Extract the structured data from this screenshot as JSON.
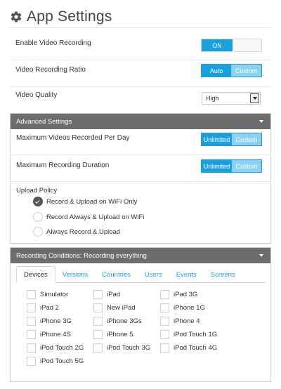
{
  "header": {
    "title": "App Settings",
    "icon": "gear-icon"
  },
  "settings": {
    "video_recording": {
      "label": "Enable Video Recording",
      "on": "ON",
      "off": ""
    },
    "ratio": {
      "label": "Video Recording Ratio",
      "auto": "Auto",
      "custom": "Custom"
    },
    "quality": {
      "label": "Video Quality",
      "value": "High"
    }
  },
  "advanced": {
    "title": "Advanced Settings",
    "max_videos": {
      "label": "Maximum Videos Recorded Per Day",
      "unlimited": "Unlimited",
      "custom": "Custom"
    },
    "max_duration": {
      "label": "Maximum Recording Duration",
      "unlimited": "Unlimited",
      "custom": "Custom"
    },
    "upload": {
      "label": "Upload Policy",
      "options": [
        "Record & Upload on WiFi Only",
        "Record Always & Upload on WiFi",
        "Always Record & Upload"
      ],
      "selected_index": 0
    }
  },
  "conditions": {
    "title": "Recording Conditions: Recording everything",
    "tabs": [
      "Devices",
      "Versions",
      "Countries",
      "Users",
      "Events",
      "Screens"
    ],
    "active_tab": "Devices",
    "devices": [
      "Simulator",
      "iPad",
      "iPad 3G",
      "iPad 2",
      "New iPad",
      "iPhone 1G",
      "iPhone 3G",
      "iPhone 3Gs",
      "iPhone 4",
      "iPhone 4S",
      "iPhone 5",
      "iPod Touch 1G",
      "iPod Touch 2G",
      "iPod Touch 3G",
      "iPod Touch 4G",
      "iPod Touch 5G"
    ]
  },
  "colors": {
    "accent": "#1aa0df",
    "accent_light": "#8dd3f1",
    "panel_header": "#6d6d6d"
  }
}
